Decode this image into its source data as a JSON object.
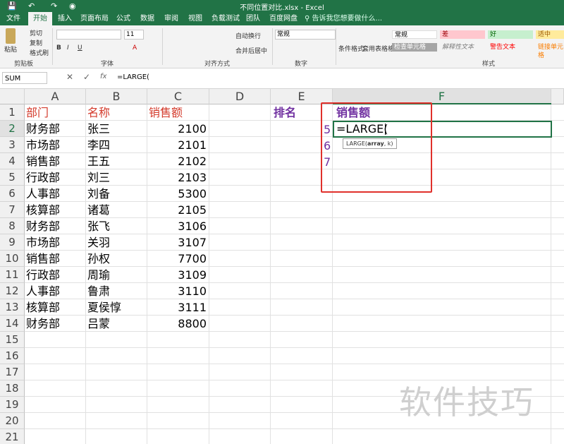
{
  "window": {
    "title": "不同位置对比.xlsx - Excel"
  },
  "tabs": [
    "文件",
    "开始",
    "插入",
    "页面布局",
    "公式",
    "数据",
    "审阅",
    "视图",
    "负载测试",
    "团队",
    "百度网盘"
  ],
  "tell_me": "告诉我您想要做什么...",
  "ribbon": {
    "clipboard": {
      "paste": "粘贴",
      "cut": "剪切",
      "copy": "复制",
      "format_painter": "格式刷",
      "label": "剪贴板"
    },
    "font": {
      "size": "11",
      "label": "字体"
    },
    "alignment": {
      "wrap": "自动换行",
      "merge": "合并后居中",
      "label": "对齐方式"
    },
    "number": {
      "format": "常规",
      "label": "数字"
    },
    "styles": {
      "cond_format": "条件格式",
      "table_format": "套用表格格式",
      "normal": "常规",
      "bad": "差",
      "good": "好",
      "neutral": "适中",
      "check_cell": "检查单元格",
      "explanatory": "解释性文本",
      "warning": "警告文本",
      "linked": "链接单元格",
      "label": "样式"
    }
  },
  "formula_bar": {
    "name_box": "SUM",
    "content": "=LARGE("
  },
  "columns": [
    "A",
    "B",
    "C",
    "D",
    "E",
    "F"
  ],
  "rows": [
    "1",
    "2",
    "3",
    "4",
    "5",
    "6",
    "7",
    "8",
    "9",
    "10",
    "11",
    "12",
    "13",
    "14",
    "15",
    "16",
    "17",
    "18",
    "19",
    "20",
    "21"
  ],
  "headers": {
    "dept": "部门",
    "name": "名称",
    "sales": "销售额",
    "rank": "排名",
    "sales_f": "销售额"
  },
  "table": [
    [
      "财务部",
      "张三",
      "2100"
    ],
    [
      "市场部",
      "李四",
      "2101"
    ],
    [
      "销售部",
      "王五",
      "2102"
    ],
    [
      "行政部",
      "刘三",
      "2103"
    ],
    [
      "人事部",
      "刘备",
      "5300"
    ],
    [
      "核算部",
      "诸葛",
      "2105"
    ],
    [
      "财务部",
      "张飞",
      "3106"
    ],
    [
      "市场部",
      "关羽",
      "3107"
    ],
    [
      "销售部",
      "孙权",
      "7700"
    ],
    [
      "行政部",
      "周瑜",
      "3109"
    ],
    [
      "人事部",
      "鲁肃",
      "3110"
    ],
    [
      "核算部",
      "夏侯惇",
      "3111"
    ],
    [
      "财务部",
      "吕蒙",
      "8800"
    ]
  ],
  "side_nums": [
    "5",
    "6",
    "7"
  ],
  "active_cell_text": "=LARGE(",
  "tooltip": {
    "fn": "LARGE(",
    "arg1": "array",
    "rest": ", k)"
  },
  "watermark": "软件技巧",
  "colors": {
    "excel_green": "#217346",
    "header_red": "#d33a2b",
    "header_purple": "#7030a0",
    "highlight_box": "#e0302b"
  }
}
